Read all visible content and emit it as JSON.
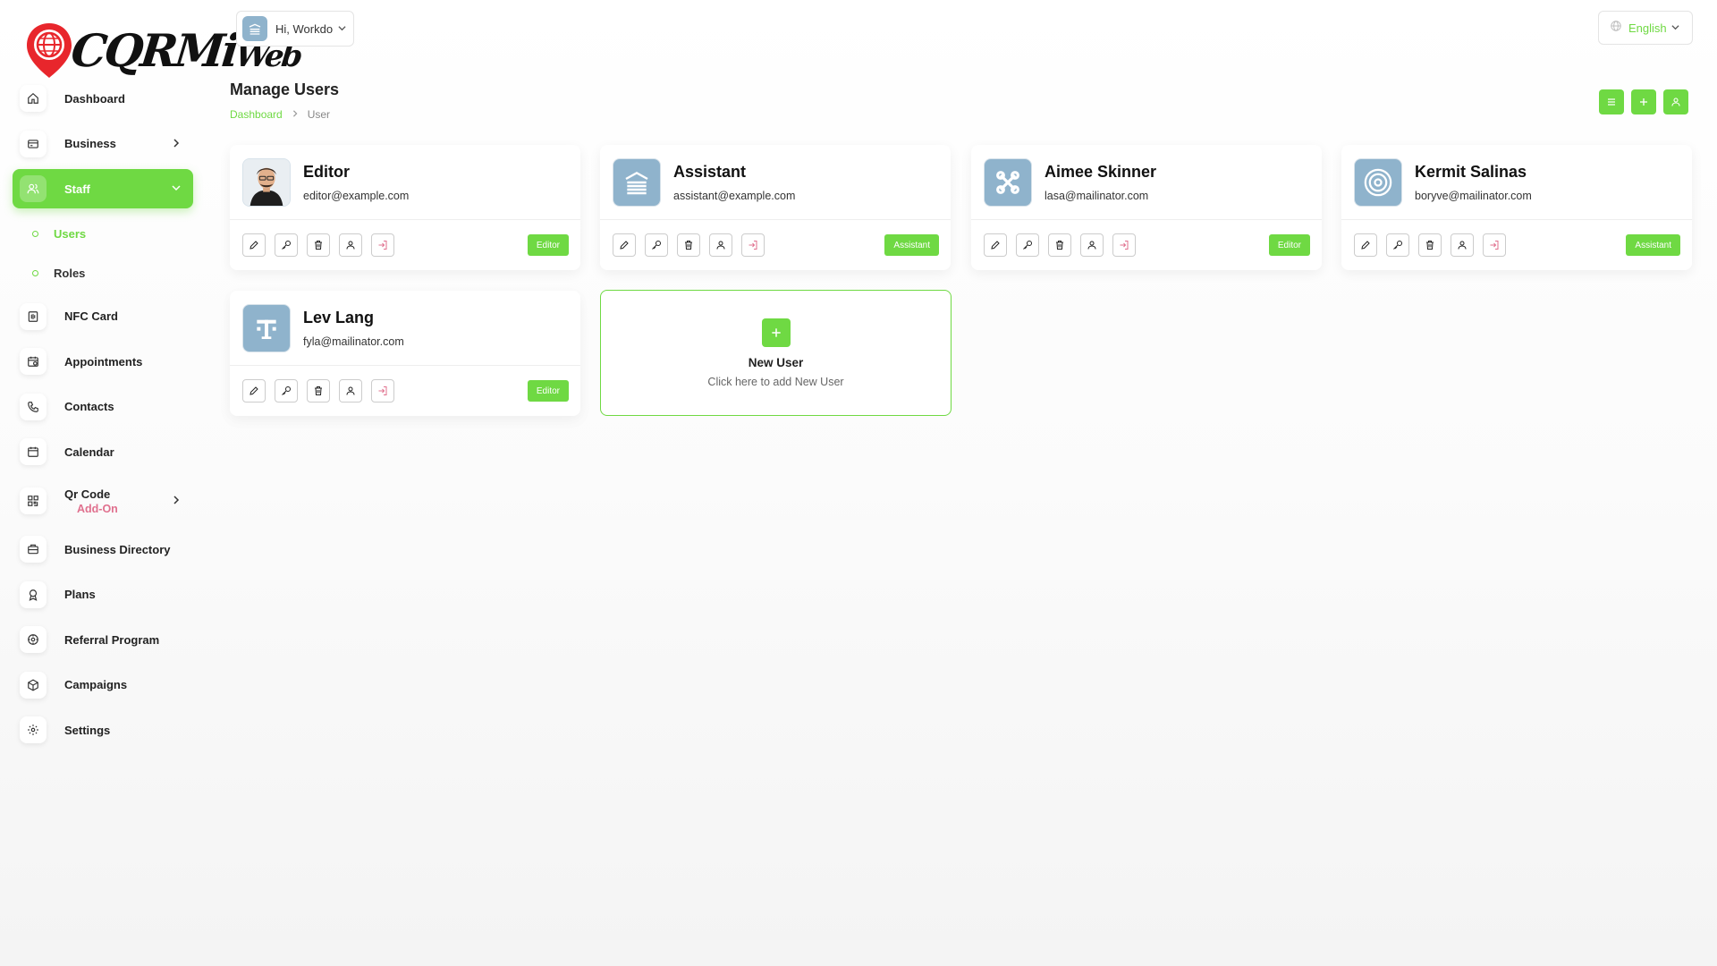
{
  "logo": {
    "text_main": "CQRMi",
    "text_tail": "Web"
  },
  "sidebar": {
    "items": [
      {
        "label": "Dashboard",
        "icon": "home-icon"
      },
      {
        "label": "Business",
        "icon": "business-icon"
      },
      {
        "label": "Staff",
        "icon": "users-icon"
      },
      {
        "label": "NFC Card",
        "icon": "nfc-card-icon"
      },
      {
        "label": "Appointments",
        "icon": "calendar-check-icon"
      },
      {
        "label": "Contacts",
        "icon": "phone-icon"
      },
      {
        "label": "Calendar",
        "icon": "calendar-icon"
      },
      {
        "label": "Qr Code",
        "icon": "qr-code-icon",
        "badge": "Add-On"
      },
      {
        "label": "Business Directory",
        "icon": "briefcase-icon"
      },
      {
        "label": "Plans",
        "icon": "award-icon"
      },
      {
        "label": "Referral Program",
        "icon": "referral-icon"
      },
      {
        "label": "Campaigns",
        "icon": "box-icon"
      },
      {
        "label": "Settings",
        "icon": "gear-icon"
      }
    ],
    "staff_sub": [
      {
        "label": "Users"
      },
      {
        "label": "Roles"
      }
    ]
  },
  "header": {
    "greeting": "Hi, Workdo",
    "language": "English"
  },
  "page": {
    "title": "Manage Users",
    "breadcrumb_home": "Dashboard",
    "breadcrumb_current": "User"
  },
  "users": [
    {
      "name": "Editor",
      "email": "editor@example.com",
      "role": "Editor"
    },
    {
      "name": "Assistant",
      "email": "assistant@example.com",
      "role": "Assistant"
    },
    {
      "name": "Aimee Skinner",
      "email": "lasa@mailinator.com",
      "role": "Editor"
    },
    {
      "name": "Kermit Salinas",
      "email": "boryve@mailinator.com",
      "role": "Assistant"
    },
    {
      "name": "Lev Lang",
      "email": "fyla@mailinator.com",
      "role": "Editor"
    }
  ],
  "new_user": {
    "title": "New User",
    "subtitle": "Click here to add New User"
  },
  "colors": {
    "accent": "#6fd943",
    "addon": "#e0708e",
    "avatar_bg": "#8fb3cc",
    "login_icon": "#e0708e"
  }
}
